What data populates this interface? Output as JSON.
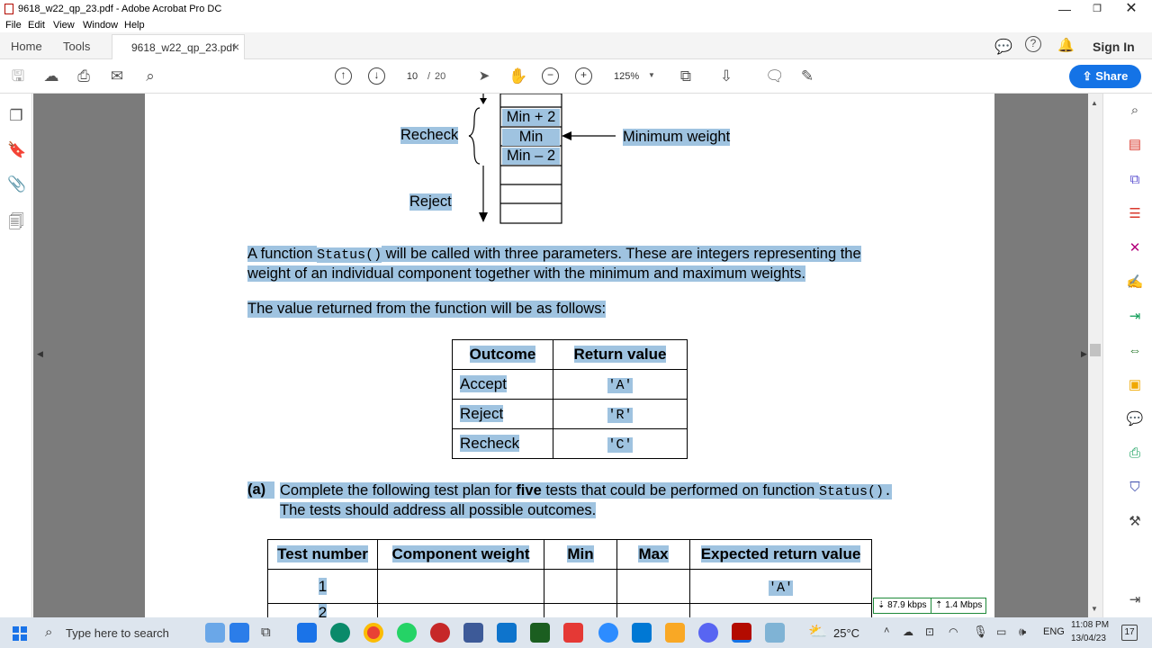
{
  "window": {
    "title": "9618_w22_qp_23.pdf - Adobe Acrobat Pro DC"
  },
  "menu": [
    "File",
    "Edit",
    "View",
    "Window",
    "Help"
  ],
  "tabs": {
    "home": "Home",
    "tools": "Tools",
    "document": "9618_w22_qp_23.pdf",
    "close": "×"
  },
  "topright": {
    "signin": "Sign In"
  },
  "toolbar": {
    "page_current": "10",
    "page_sep": "/",
    "page_total": "20",
    "zoom": "125%",
    "share": "Share"
  },
  "diagram": {
    "cells": [
      "Min + 2",
      "Min",
      "Min – 2"
    ],
    "recheck": "Recheck",
    "reject": "Reject",
    "min_weight": "Minimum weight"
  },
  "para1": {
    "a": "A function ",
    "code": "Status()",
    "b": " will be called with three parameters. These are integers representing the",
    "line2": "weight of an individual component together with the minimum and maximum weights."
  },
  "para2": "The value returned from the function will be as follows:",
  "outcome_table": {
    "headers": [
      "Outcome",
      "Return value"
    ],
    "rows": [
      [
        "Accept",
        "'A'"
      ],
      [
        "Reject",
        "'R'"
      ],
      [
        "Recheck",
        "'C'"
      ]
    ]
  },
  "question": {
    "label": "(a)",
    "t1": "Complete the following test plan for ",
    "bold": "five",
    "t2": " tests that could be performed on function ",
    "code": "Status().",
    "line2": "The tests should address all possible outcomes."
  },
  "test_table": {
    "headers": [
      "Test number",
      "Component weight",
      "Min",
      "Max",
      "Expected return value"
    ],
    "row1": [
      "1",
      "",
      "",
      "",
      "'A'"
    ],
    "row2_num": "2"
  },
  "network": {
    "down": "87.9 kbps",
    "up": "1.4 Mbps"
  },
  "taskbar": {
    "search": "Type here to search",
    "weather": "25°C",
    "lang": "ENG",
    "time": "11:08 PM",
    "date": "13/04/23",
    "notif": "17"
  }
}
